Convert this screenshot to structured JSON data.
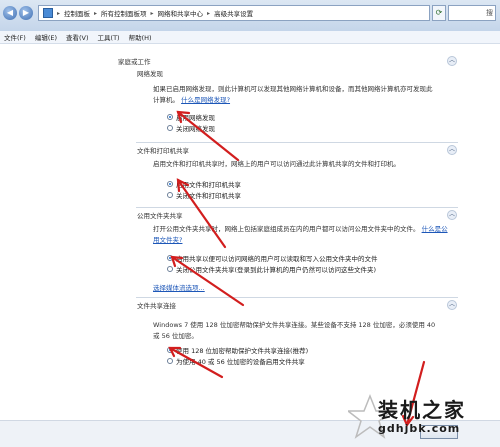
{
  "address": {
    "crumbs": [
      "控制面板",
      "所有控制面板项",
      "网络和共享中心",
      "高级共享设置"
    ],
    "search_hint": "搜"
  },
  "menu": [
    "文件(F)",
    "编辑(E)",
    "查看(V)",
    "工具(T)",
    "帮助(H)"
  ],
  "profile": {
    "title": "家庭或工作"
  },
  "sections": {
    "discovery": {
      "title": "网络发现",
      "desc": "如果已启用网络发现，则此计算机可以发现其他网络计算机和设备，而其他网络计算机亦可发现此",
      "desc2": "计算机。",
      "link": "什么是网络发现?",
      "options": [
        "启用网络发现",
        "关闭网络发现"
      ]
    },
    "printer": {
      "title": "文件和打印机共享",
      "desc": "启用文件和打印机共享时，网络上的用户可以访问通过此计算机共享的文件和打印机。",
      "options": [
        "启用文件和打印机共享",
        "关闭文件和打印机共享"
      ]
    },
    "public": {
      "title": "公用文件夹共享",
      "desc": "打开公用文件夹共享时，网络上包括家庭组成员在内的用户都可以访问公用文件夹中的文件。",
      "link": "什么是公用文件夹?",
      "options": [
        "启用共享以便可以访问网络的用户可以读取和写入公用文件夹中的文件",
        "关闭公用文件夹共享(登录到此计算机的用户仍然可以访问这些文件夹)"
      ],
      "media_link": "选择媒体流选项..."
    },
    "connection": {
      "title": "文件共享连接",
      "desc": "Windows 7 使用 128 位加密帮助保护文件共享连接。某些设备不支持 128 位加密，必须使用 40",
      "desc2": "或 56 位加密。",
      "options": [
        "使用 128 位加密帮助保护文件共享连接(推荐)",
        "为使用 40 或 56 位加密的设备启用文件共享"
      ]
    }
  },
  "watermark": {
    "title": "装机之家",
    "url": "gdhjbk.com"
  },
  "colors": {
    "accent": "#1d57b8",
    "arrow": "#d21e1e"
  }
}
